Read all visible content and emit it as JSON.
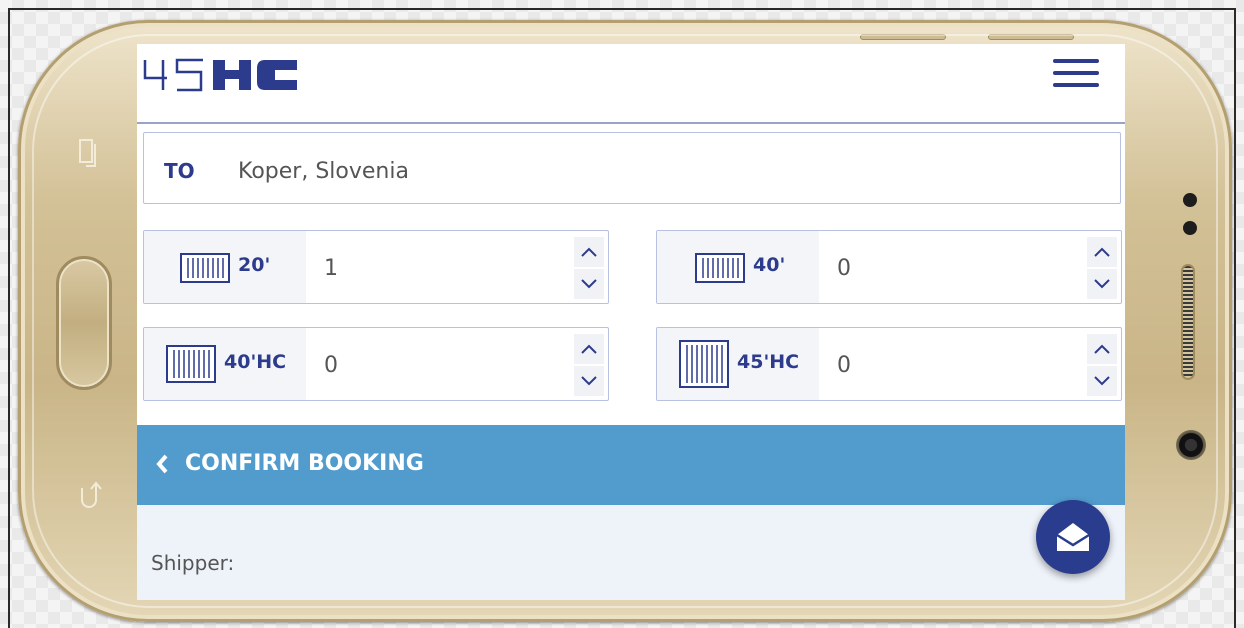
{
  "header": {
    "logo_text": "45HC",
    "menu_icon": "hamburger-icon"
  },
  "destination": {
    "label": "TO",
    "value": "Koper, Slovenia"
  },
  "containers": [
    {
      "label": "20'",
      "value": "1"
    },
    {
      "label": "40'",
      "value": "0"
    },
    {
      "label": "40'HC",
      "value": "0"
    },
    {
      "label": "45'HC",
      "value": "0"
    }
  ],
  "confirm": {
    "label": "CONFIRM BOOKING",
    "icon": "chevron-left-icon"
  },
  "form": {
    "shipper_label": "Shipper:"
  },
  "fab": {
    "icon": "mail-open-icon"
  },
  "colors": {
    "brand": "#2d3b8c",
    "bar": "#519ccd",
    "gold": "#d3c197"
  }
}
